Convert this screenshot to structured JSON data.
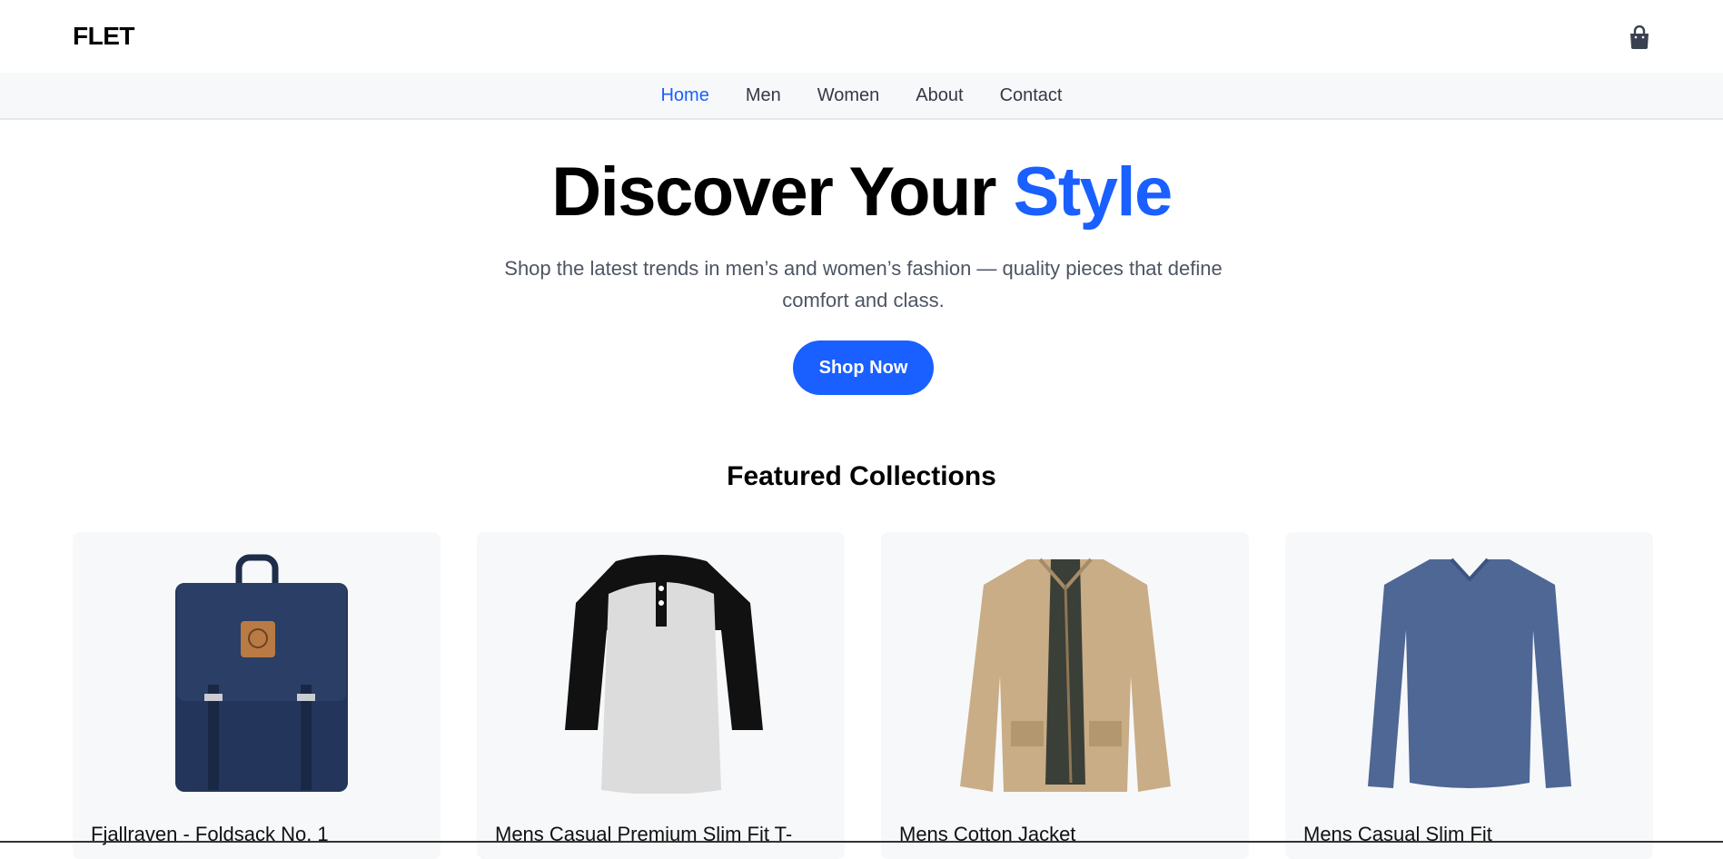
{
  "header": {
    "logo": "FLET",
    "cart_icon": "shopping-bag-icon"
  },
  "nav": {
    "items": [
      {
        "label": "Home",
        "active": true
      },
      {
        "label": "Men",
        "active": false
      },
      {
        "label": "Women",
        "active": false
      },
      {
        "label": "About",
        "active": false
      },
      {
        "label": "Contact",
        "active": false
      }
    ]
  },
  "hero": {
    "title_main": "Discover Your ",
    "title_accent": "Style",
    "subtitle": "Shop the latest trends in men’s and women’s fashion — quality pieces that define comfort and class.",
    "cta_label": "Shop Now"
  },
  "featured": {
    "title": "Featured Collections",
    "products": [
      {
        "title": "Fjallraven - Foldsack No. 1",
        "image": "navy-backpack"
      },
      {
        "title": "Mens Casual Premium Slim Fit T-",
        "image": "raglan-henley-shirt"
      },
      {
        "title": "Mens Cotton Jacket",
        "image": "khaki-jacket"
      },
      {
        "title": "Mens Casual Slim Fit",
        "image": "blue-long-sleeve-shirt"
      }
    ]
  },
  "colors": {
    "accent": "#1a5fff",
    "nav_bg": "#f7f8fa",
    "card_bg": "#f7f8fa"
  }
}
